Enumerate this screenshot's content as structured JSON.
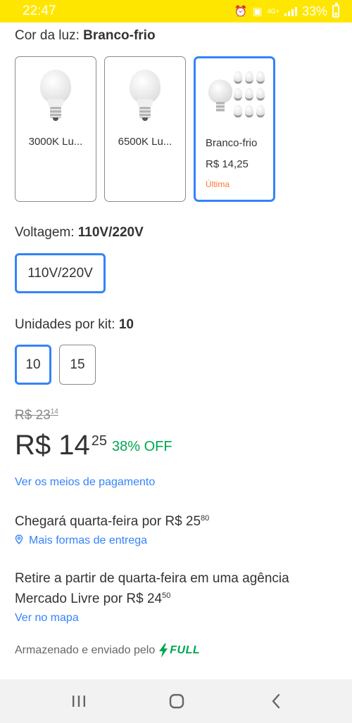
{
  "status_bar": {
    "time": "22:47",
    "network": "4G+",
    "battery": "33%"
  },
  "color_section": {
    "label": "Cor da luz: ",
    "selected": "Branco-frio"
  },
  "variants": [
    {
      "name": "3000K Lu...",
      "price": "",
      "stock": "",
      "selected": false
    },
    {
      "name": "6500K Lu...",
      "price": "",
      "stock": "",
      "selected": false
    },
    {
      "name": "Branco-frio",
      "price": "R$ 14,25",
      "stock": "Última",
      "selected": true
    }
  ],
  "voltage_section": {
    "label": "Voltagem: ",
    "selected": "110V/220V",
    "options": [
      "110V/220V"
    ]
  },
  "units_section": {
    "label": "Unidades por kit: ",
    "selected": "10",
    "options": [
      "10",
      "15"
    ]
  },
  "price": {
    "old_integer": "R$ 23",
    "old_cents": "14",
    "integer": "R$ 14",
    "cents": "25",
    "discount": "38% OFF"
  },
  "payment_link": "Ver os meios de pagamento",
  "shipping": {
    "delivery_text": "Chegará quarta-feira por R$ 25",
    "delivery_cents": "80",
    "more_options_link": "Mais formas de entrega",
    "pickup_text": "Retire a partir de quarta-feira em uma agência Mercado Livre por R$ 24",
    "pickup_cents": "50",
    "map_link": "Ver no mapa"
  },
  "fulfillment": {
    "text": "Armazenado e enviado pelo",
    "badge": "FULL"
  },
  "colors": {
    "accent": "#3483fa",
    "success": "#00a650",
    "warning": "#ff7733",
    "statusbar": "#ffe600"
  }
}
